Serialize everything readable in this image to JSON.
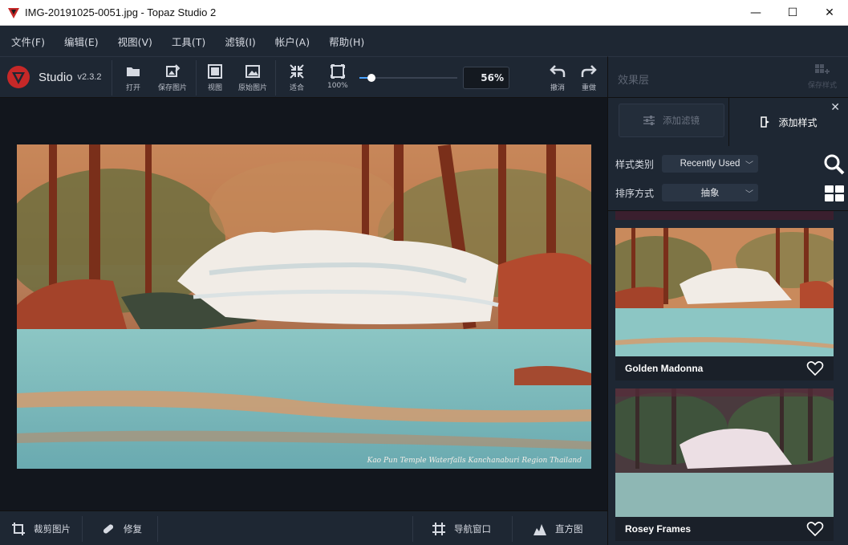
{
  "window": {
    "title": "IMG-20191025-0051.jpg - Topaz Studio 2",
    "minimize": "—",
    "maximize": "☐",
    "close": "✕"
  },
  "menu": [
    "文件(F)",
    "编辑(E)",
    "视图(V)",
    "工具(T)",
    "滤镜(I)",
    "帐户(A)",
    "帮助(H)"
  ],
  "brand": {
    "name": "Studio",
    "version": "v2.3.2"
  },
  "toolbar": {
    "open": "打开",
    "save_image": "保存图片",
    "view": "视图",
    "original": "原始图片",
    "fit": "适合",
    "hundred": "100%",
    "zoom_value": "56%",
    "undo": "撤消",
    "redo": "重做",
    "zoom_fraction": 0.12
  },
  "right_header": {
    "title": "效果层",
    "save_style": "保存样式"
  },
  "panel": {
    "add_filter": "添加滤镜",
    "add_style": "添加样式",
    "close": "✕",
    "category_label": "样式类别",
    "category_value": "Recently Used",
    "sort_label": "排序方式",
    "sort_value": "抽象"
  },
  "styles": [
    {
      "name": "Golden Madonna"
    },
    {
      "name": "Rosey Frames"
    }
  ],
  "photo_caption": "Kao Pun Temple Waterfalls  Kanchanaburi Region  Thailand",
  "bottombar": {
    "crop": "裁剪图片",
    "repair": "修复",
    "navigator": "导航窗口",
    "histogram": "直方图"
  },
  "colors": {
    "accent": "#4aa3ff",
    "bg": "#1e2733",
    "canvas": "#12161d"
  }
}
